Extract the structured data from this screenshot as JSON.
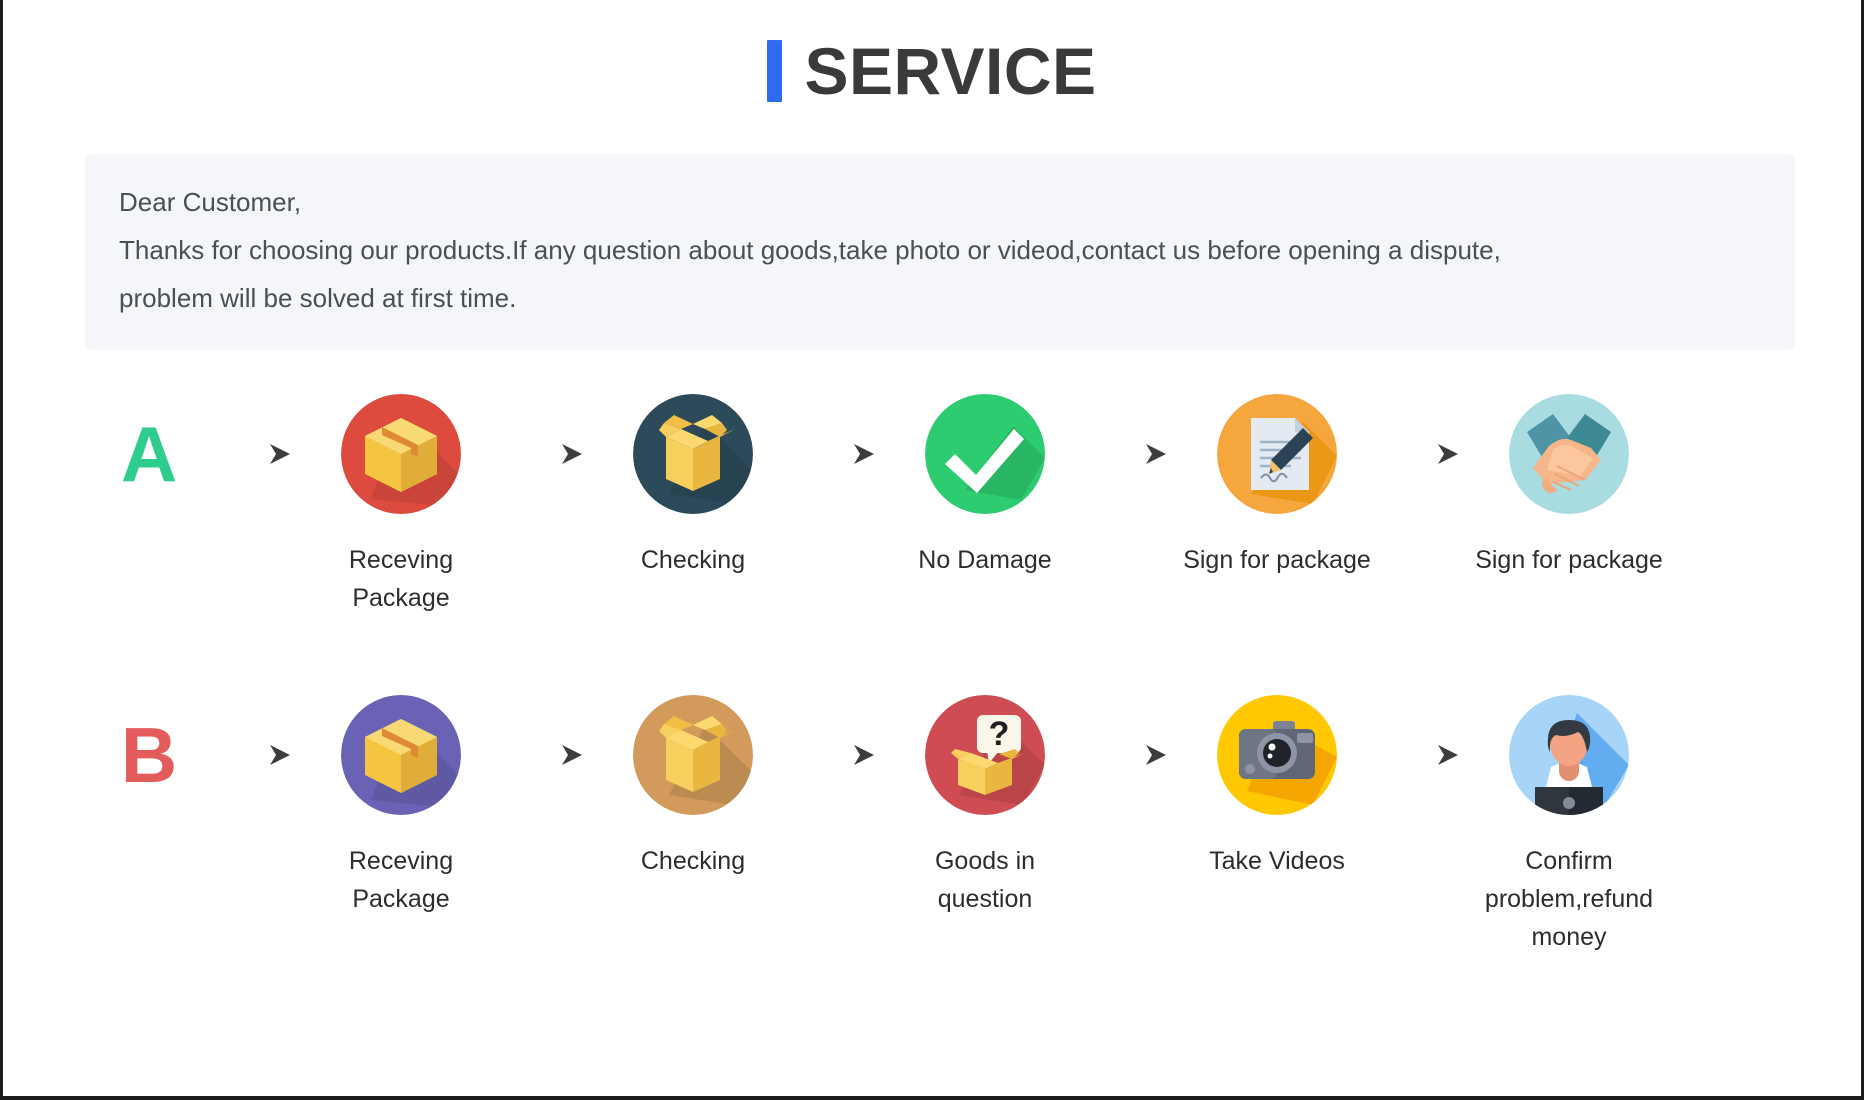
{
  "header": {
    "title": "SERVICE",
    "accent_color": "#2e6bf0",
    "title_color": "#3a3a3a"
  },
  "notice": {
    "background": "#f4f6f9",
    "lines": [
      "Dear Customer,",
      "Thanks for choosing our products.If any question about goods,take photo or videod,contact us before opening a dispute,",
      "problem will be solved at first time."
    ]
  },
  "flows": [
    {
      "letter": "A",
      "letter_color": "#2ecc8d",
      "steps": [
        {
          "label": "Receving Package",
          "icon": "package-box-icon",
          "circle_color": "#dc4b3e"
        },
        {
          "label": "Checking",
          "icon": "open-box-icon",
          "circle_color": "#2c4a5a"
        },
        {
          "label": "No Damage",
          "icon": "checkmark-icon",
          "circle_color": "#2ecc71"
        },
        {
          "label": "Sign for package",
          "icon": "document-pen-icon",
          "circle_color": "#f5a73e"
        },
        {
          "label": "Sign for package",
          "icon": "handshake-icon",
          "circle_color": "#a8dce0"
        }
      ]
    },
    {
      "letter": "B",
      "letter_color": "#e35b5b",
      "steps": [
        {
          "label": "Receving Package",
          "icon": "package-box-icon",
          "circle_color": "#6a63b5"
        },
        {
          "label": "Checking",
          "icon": "open-box-icon",
          "circle_color": "#d29b5c"
        },
        {
          "label": "Goods in question",
          "icon": "question-box-icon",
          "circle_color": "#cf4d52"
        },
        {
          "label": "Take Videos",
          "icon": "camera-icon",
          "circle_color": "#ffc800"
        },
        {
          "label": "Confirm problem,refund money",
          "icon": "support-person-icon",
          "circle_color": "#a8d5f7"
        }
      ]
    }
  ]
}
